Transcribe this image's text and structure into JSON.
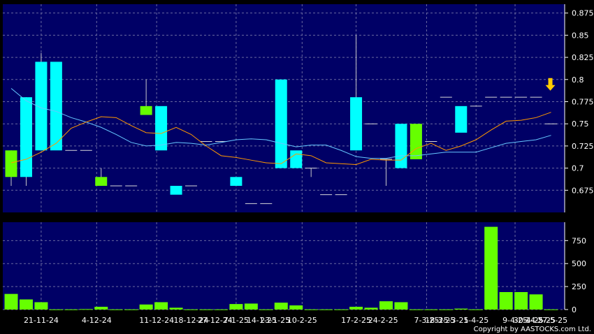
{
  "chart_data": [
    {
      "type": "candlestick",
      "panel": "price",
      "ylim": [
        0.65,
        0.885
      ],
      "yticks": [
        0.675,
        0.7,
        0.725,
        0.75,
        0.775,
        0.8,
        0.825,
        0.85,
        0.875
      ],
      "grid": true,
      "categories": [
        "1",
        "2",
        "3",
        "4",
        "5",
        "6",
        "7",
        "8",
        "9",
        "10",
        "11",
        "12",
        "13",
        "14",
        "15",
        "16",
        "17",
        "18",
        "19",
        "20",
        "21",
        "22",
        "23",
        "24",
        "25",
        "26",
        "27",
        "28",
        "29",
        "30",
        "31",
        "32",
        "33",
        "34",
        "35",
        "36",
        "37"
      ],
      "candles": [
        {
          "o": 0.69,
          "c": 0.72,
          "h": 0.72,
          "l": 0.68
        },
        {
          "o": 0.78,
          "c": 0.69,
          "h": 0.78,
          "l": 0.68
        },
        {
          "o": 0.82,
          "c": 0.72,
          "h": 0.83,
          "l": 0.72
        },
        {
          "o": 0.82,
          "c": 0.72,
          "h": 0.82,
          "l": 0.72
        },
        {
          "o": 0.72,
          "c": 0.72,
          "h": 0.72,
          "l": 0.72
        },
        {
          "o": 0.72,
          "c": 0.72,
          "h": 0.72,
          "l": 0.72
        },
        {
          "o": 0.68,
          "c": 0.69,
          "h": 0.7,
          "l": 0.68
        },
        {
          "o": 0.68,
          "c": 0.68,
          "h": 0.68,
          "l": 0.68
        },
        {
          "o": 0.68,
          "c": 0.68,
          "h": 0.68,
          "l": 0.68
        },
        {
          "o": 0.76,
          "c": 0.77,
          "h": 0.8,
          "l": 0.76
        },
        {
          "o": 0.77,
          "c": 0.72,
          "h": 0.77,
          "l": 0.72
        },
        {
          "o": 0.68,
          "c": 0.67,
          "h": 0.68,
          "l": 0.67
        },
        {
          "o": 0.68,
          "c": 0.68,
          "h": 0.68,
          "l": 0.68
        },
        {
          "o": 0.73,
          "c": 0.73,
          "h": 0.73,
          "l": 0.73
        },
        {
          "o": 0.73,
          "c": 0.73,
          "h": 0.73,
          "l": 0.73
        },
        {
          "o": 0.69,
          "c": 0.68,
          "h": 0.69,
          "l": 0.68
        },
        {
          "o": 0.66,
          "c": 0.66,
          "h": 0.66,
          "l": 0.66
        },
        {
          "o": 0.66,
          "c": 0.66,
          "h": 0.66,
          "l": 0.66
        },
        {
          "o": 0.8,
          "c": 0.7,
          "h": 0.8,
          "l": 0.7
        },
        {
          "o": 0.72,
          "c": 0.7,
          "h": 0.72,
          "l": 0.7
        },
        {
          "o": 0.7,
          "c": 0.7,
          "h": 0.7,
          "l": 0.69
        },
        {
          "o": 0.67,
          "c": 0.67,
          "h": 0.67,
          "l": 0.67
        },
        {
          "o": 0.67,
          "c": 0.67,
          "h": 0.67,
          "l": 0.67
        },
        {
          "o": 0.78,
          "c": 0.72,
          "h": 0.85,
          "l": 0.72
        },
        {
          "o": 0.75,
          "c": 0.75,
          "h": 0.75,
          "l": 0.75
        },
        {
          "o": 0.71,
          "c": 0.71,
          "h": 0.71,
          "l": 0.68
        },
        {
          "o": 0.75,
          "c": 0.7,
          "h": 0.75,
          "l": 0.7
        },
        {
          "o": 0.71,
          "c": 0.75,
          "h": 0.75,
          "l": 0.71
        },
        {
          "o": 0.73,
          "c": 0.73,
          "h": 0.73,
          "l": 0.73
        },
        {
          "o": 0.78,
          "c": 0.78,
          "h": 0.78,
          "l": 0.78
        },
        {
          "o": 0.77,
          "c": 0.74,
          "h": 0.77,
          "l": 0.74
        },
        {
          "o": 0.77,
          "c": 0.77,
          "h": 0.77,
          "l": 0.77
        },
        {
          "o": 0.78,
          "c": 0.78,
          "h": 0.78,
          "l": 0.78
        },
        {
          "o": 0.78,
          "c": 0.78,
          "h": 0.78,
          "l": 0.78
        },
        {
          "o": 0.78,
          "c": 0.78,
          "h": 0.78,
          "l": 0.78
        },
        {
          "o": 0.78,
          "c": 0.78,
          "h": 0.78,
          "l": 0.78
        },
        {
          "o": 0.75,
          "c": 0.75,
          "h": 0.75,
          "l": 0.75
        }
      ],
      "ma_blue": [
        0.79,
        0.776,
        0.768,
        0.764,
        0.757,
        0.752,
        0.746,
        0.738,
        0.729,
        0.725,
        0.726,
        0.729,
        0.728,
        0.726,
        0.729,
        0.732,
        0.733,
        0.732,
        0.728,
        0.724,
        0.726,
        0.726,
        0.72,
        0.713,
        0.711,
        0.711,
        0.714,
        0.714,
        0.716,
        0.718,
        0.718,
        0.718,
        0.723,
        0.728,
        0.73,
        0.732,
        0.737
      ],
      "ma_orange": [
        0.706,
        0.71,
        0.718,
        0.728,
        0.745,
        0.752,
        0.758,
        0.757,
        0.748,
        0.74,
        0.739,
        0.746,
        0.738,
        0.725,
        0.714,
        0.712,
        0.709,
        0.706,
        0.705,
        0.716,
        0.714,
        0.706,
        0.705,
        0.704,
        0.71,
        0.709,
        0.709,
        0.722,
        0.728,
        0.72,
        0.725,
        0.732,
        0.743,
        0.753,
        0.754,
        0.757,
        0.763
      ],
      "colors": {
        "up": "#66ff00",
        "down": "#00ffff",
        "ma_blue": "#66c8ff",
        "ma_orange": "#ff9900",
        "background": "#000066",
        "grid": "#6a6aa0",
        "arrow": "#ffcc00"
      }
    },
    {
      "type": "bar",
      "panel": "volume",
      "ylim": [
        0,
        950
      ],
      "yticks": [
        0,
        250,
        500,
        750
      ],
      "grid": true,
      "values": [
        170,
        110,
        80,
        2,
        2,
        5,
        30,
        2,
        2,
        55,
        80,
        20,
        2,
        2,
        2,
        60,
        65,
        2,
        75,
        45,
        2,
        2,
        2,
        30,
        20,
        90,
        80,
        2,
        2,
        2,
        10,
        2,
        900,
        190,
        190,
        165,
        2
      ],
      "colors": {
        "bar": "#66ff00",
        "background": "#000066"
      }
    }
  ],
  "x_ticks": [
    {
      "index": 2,
      "label": "21-11-24"
    },
    {
      "index": 5.7,
      "label": "4-12-24"
    },
    {
      "index": 9.7,
      "label": "11-12-24"
    },
    {
      "index": 12,
      "label": "18-12-24"
    },
    {
      "index": 13.6,
      "label": "27-12-24"
    },
    {
      "index": 15,
      "label": "7-1-25"
    },
    {
      "index": 16.7,
      "label": "14-1-25"
    },
    {
      "index": 17.6,
      "label": "23-1-25"
    },
    {
      "index": 19.4,
      "label": "10-2-25"
    },
    {
      "index": 23,
      "label": "17-2-25"
    },
    {
      "index": 24.8,
      "label": "24-2-25"
    },
    {
      "index": 27.7,
      "label": "7-3-25"
    },
    {
      "index": 28.6,
      "label": "18-3-25"
    },
    {
      "index": 29.5,
      "label": "25-3-25"
    },
    {
      "index": 31,
      "label": "1-4-25"
    },
    {
      "index": 33.6,
      "label": "9-4-25"
    },
    {
      "index": 34.5,
      "label": "30-4-25"
    },
    {
      "index": 35.3,
      "label": "14-5-25"
    },
    {
      "index": 36.1,
      "label": "27-5-25"
    }
  ],
  "copyright": "Copyright by AASTOCKS.com Ltd."
}
